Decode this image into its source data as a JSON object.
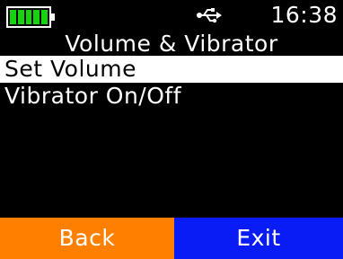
{
  "status_bar": {
    "time": "16:38",
    "battery_level": 1.0,
    "battery_color": "#16d20f",
    "connection_icon": "usb-icon"
  },
  "title": "Volume & Vibrator",
  "menu": {
    "items": [
      {
        "label": "Set Volume",
        "selected": true
      },
      {
        "label": "Vibrator On/Off",
        "selected": false
      }
    ]
  },
  "softkeys": {
    "left_label": "Back",
    "left_color": "#ff8000",
    "right_label": "Exit",
    "right_color": "#0a1cf5"
  }
}
